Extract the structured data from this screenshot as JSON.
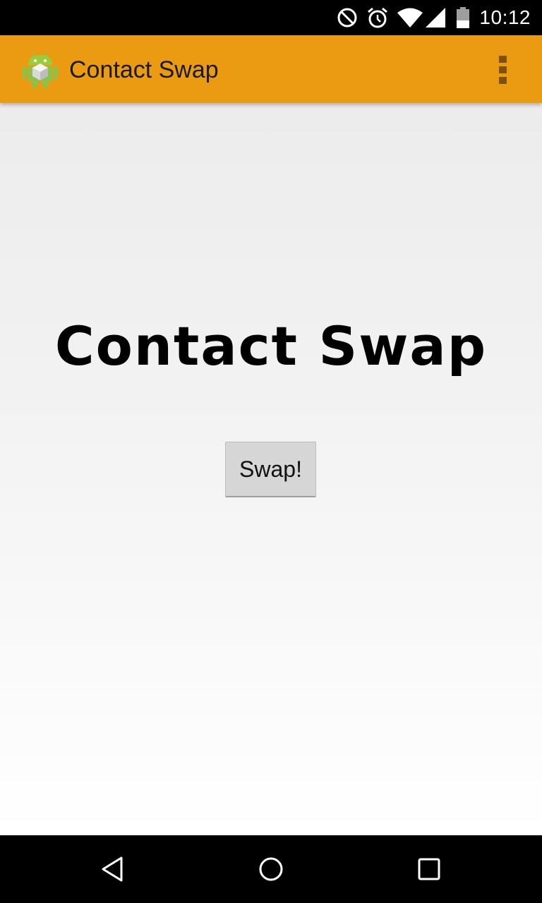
{
  "status_bar": {
    "time": "10:12",
    "icons": [
      "do-not-disturb-icon",
      "alarm-icon",
      "wifi-icon",
      "cell-signal-icon",
      "battery-icon"
    ]
  },
  "action_bar": {
    "title": "Contact Swap",
    "app_icon": "android-app-icon",
    "overflow_icon": "overflow-menu-icon",
    "background_color": "#EA9B12"
  },
  "main": {
    "logo_text": "Contact Swap",
    "swap_button_label": "Swap!"
  },
  "nav_bar": {
    "icons": [
      "back-icon",
      "home-icon",
      "recents-icon"
    ]
  }
}
